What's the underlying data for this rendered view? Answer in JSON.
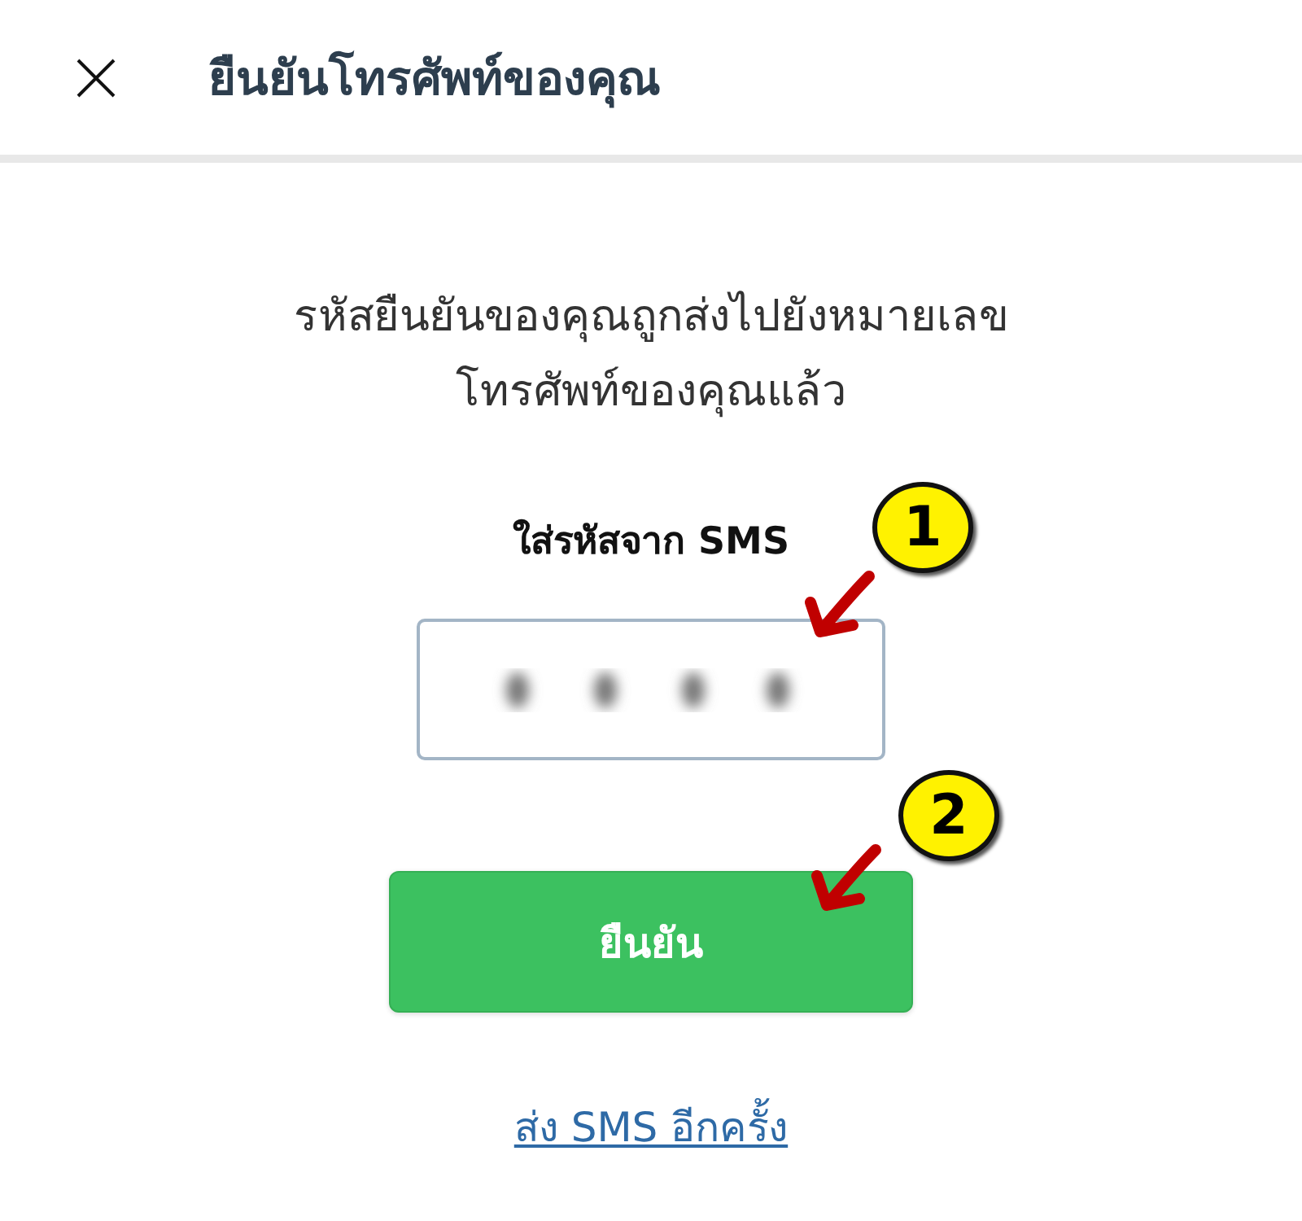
{
  "header": {
    "title": "ยืนยันโทรศัพท์ของคุณ"
  },
  "message": [
    "รหัสยืนยันของคุณถูกส่งไปยังหมายเลข",
    "โทรศัพท์ของคุณแล้ว"
  ],
  "code_field": {
    "label": "ใส่รหัสจาก SMS"
  },
  "confirm_button": "ยืนยัน",
  "resend_link": "ส่ง SMS อีกครั้ง",
  "annotations": [
    {
      "number": "1"
    },
    {
      "number": "2"
    }
  ]
}
